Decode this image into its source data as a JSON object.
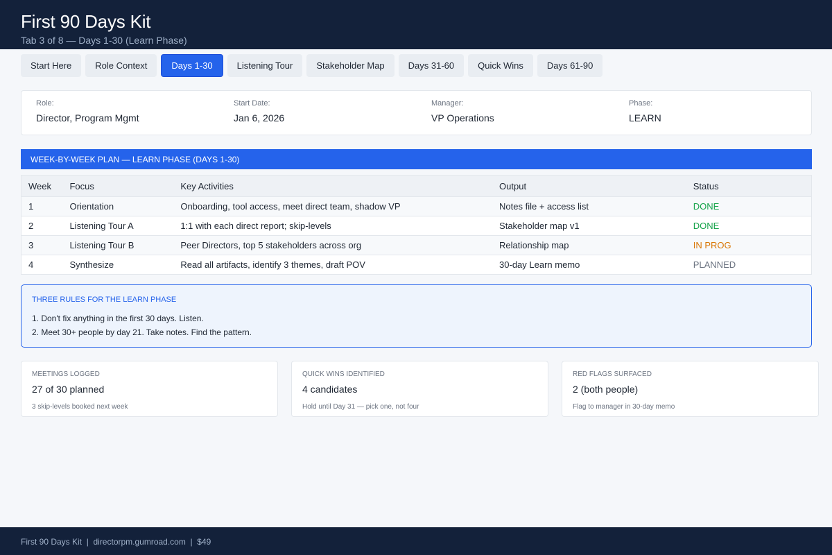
{
  "header": {
    "title": "First 90 Days Kit",
    "subtitle": "Tab 3 of 8 — Days 1-30 (Learn Phase)"
  },
  "tabs": [
    {
      "label": "Start Here"
    },
    {
      "label": "Role Context"
    },
    {
      "label": "Days 1-30",
      "active": true
    },
    {
      "label": "Listening Tour"
    },
    {
      "label": "Stakeholder Map"
    },
    {
      "label": "Days 31-60"
    },
    {
      "label": "Quick Wins"
    },
    {
      "label": "Days 61-90"
    }
  ],
  "info": {
    "role": {
      "label": "Role:",
      "value": "Director, Program Mgmt"
    },
    "start_date": {
      "label": "Start Date:",
      "value": "Jan 6, 2026"
    },
    "manager": {
      "label": "Manager:",
      "value": "VP Operations"
    },
    "phase": {
      "label": "Phase:",
      "value": "LEARN"
    }
  },
  "plan": {
    "section_title": "WEEK-BY-WEEK PLAN — LEARN PHASE (DAYS 1-30)",
    "columns": [
      "Week",
      "Focus",
      "Key Activities",
      "Output",
      "Status"
    ],
    "rows": [
      {
        "week": "1",
        "focus": "Orientation",
        "activities": "Onboarding, tool access, meet direct team, shadow VP",
        "output": "Notes file + access list",
        "status": "DONE"
      },
      {
        "week": "2",
        "focus": "Listening Tour A",
        "activities": "1:1 with each direct report; skip-levels",
        "output": "Stakeholder map v1",
        "status": "DONE"
      },
      {
        "week": "3",
        "focus": "Listening Tour B",
        "activities": "Peer Directors, top 5 stakeholders across org",
        "output": "Relationship map",
        "status": "IN PROG"
      },
      {
        "week": "4",
        "focus": "Synthesize",
        "activities": "Read all artifacts, identify 3 themes, draft POV",
        "output": "30-day Learn memo",
        "status": "PLANNED"
      }
    ]
  },
  "status_colors": {
    "DONE": "#16a34a",
    "IN PROG": "#d97706",
    "PLANNED": "#6b7380"
  },
  "rules": {
    "title": "THREE RULES FOR THE LEARN PHASE",
    "items": [
      "1. Don't fix anything in the first 30 days. Listen.",
      "2. Meet 30+ people by day 21. Take notes. Find the pattern."
    ]
  },
  "stats": [
    {
      "label": "MEETINGS LOGGED",
      "value": "27 of 30 planned",
      "note": "3 skip-levels booked next week"
    },
    {
      "label": "QUICK WINS IDENTIFIED",
      "value": "4 candidates",
      "note": "Hold until Day 31 — pick one, not four"
    },
    {
      "label": "RED FLAGS SURFACED",
      "value": "2 (both people)",
      "note": "Flag to manager in 30-day memo"
    }
  ],
  "footer": {
    "text": "First 90 Days Kit  |  directorpm.gumroad.com  |  $49"
  },
  "colors": {
    "header_bg": "#13213a",
    "accent": "#2563eb"
  }
}
